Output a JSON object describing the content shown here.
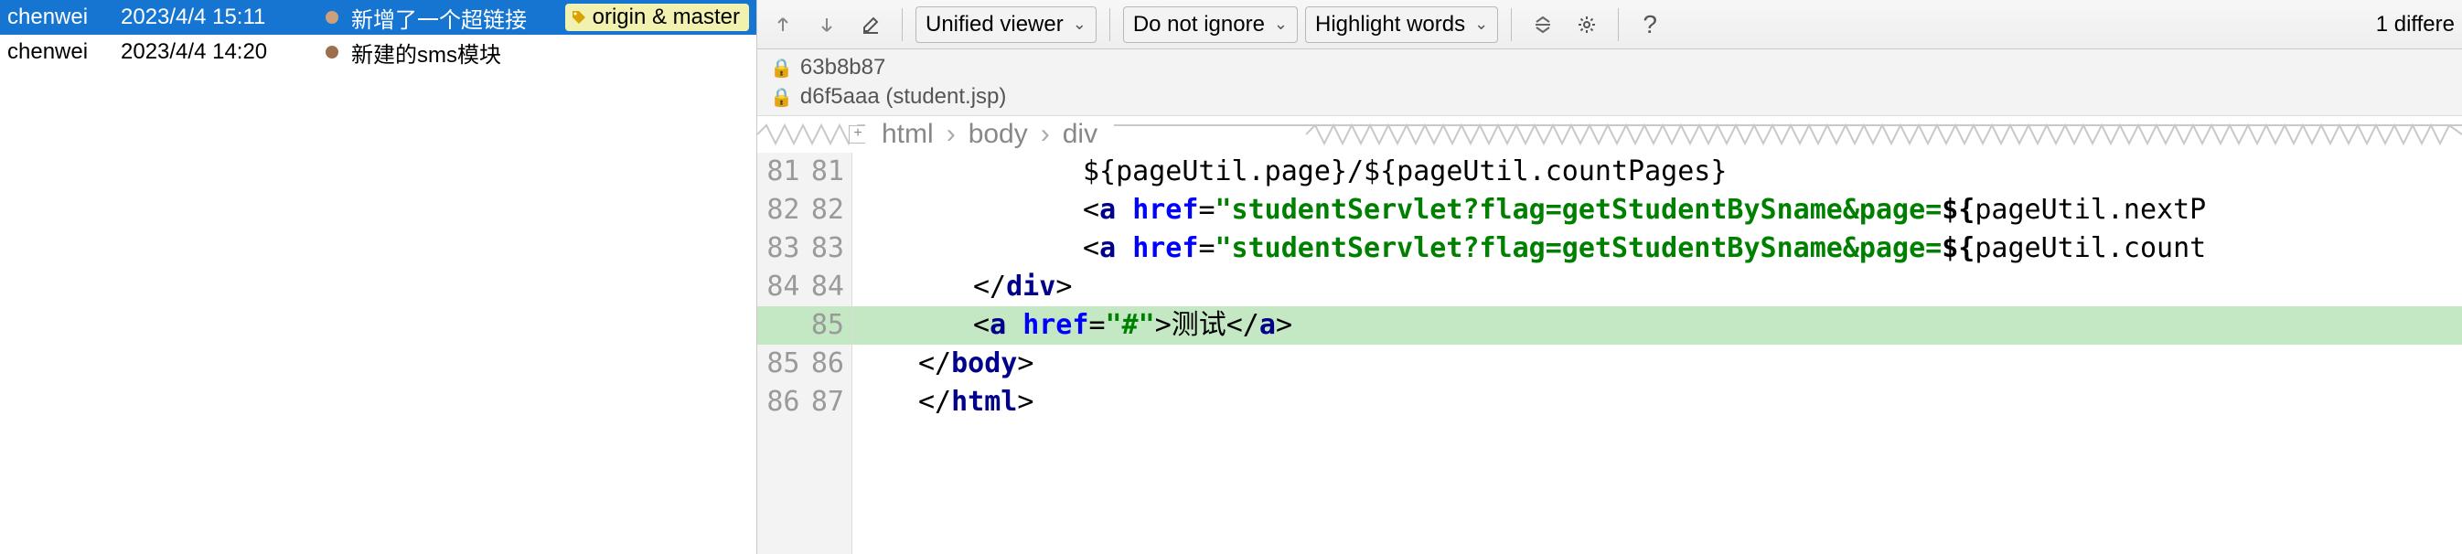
{
  "commits": [
    {
      "author": "chenwei",
      "date": "2023/4/4 15:11",
      "message": "新增了一个超链接",
      "tag": "origin & master",
      "selected": true
    },
    {
      "author": "chenwei",
      "date": "2023/4/4 14:20",
      "message": "新建的sms模块",
      "tag": null,
      "selected": false
    }
  ],
  "toolbar": {
    "viewer_label": "Unified viewer",
    "ignore_label": "Do not ignore",
    "highlight_label": "Highlight words",
    "diff_count": "1 differe"
  },
  "revisions": {
    "base": "63b8b87",
    "head": "d6f5aaa (student.jsp)"
  },
  "breadcrumb": [
    "html",
    "body",
    "div"
  ],
  "code": {
    "lines": [
      {
        "a": "81",
        "b": "81",
        "indent": 3,
        "added": false,
        "tokens": [
          {
            "t": "expr",
            "v": "${pageUtil.page}"
          },
          {
            "t": "text",
            "v": "/"
          },
          {
            "t": "expr",
            "v": "${pageUtil.countPages}"
          }
        ]
      },
      {
        "a": "82",
        "b": "82",
        "indent": 3,
        "added": false,
        "tokens": [
          {
            "t": "punc",
            "v": "<"
          },
          {
            "t": "tag",
            "v": "a "
          },
          {
            "t": "attr",
            "v": "href"
          },
          {
            "t": "punc",
            "v": "="
          },
          {
            "t": "str",
            "v": "\"studentServlet?flag=getStudentBySname&page="
          },
          {
            "t": "br",
            "v": "${"
          },
          {
            "t": "expr",
            "v": "pageUtil.nextP"
          }
        ]
      },
      {
        "a": "83",
        "b": "83",
        "indent": 3,
        "added": false,
        "tokens": [
          {
            "t": "punc",
            "v": "<"
          },
          {
            "t": "tag",
            "v": "a "
          },
          {
            "t": "attr",
            "v": "href"
          },
          {
            "t": "punc",
            "v": "="
          },
          {
            "t": "str",
            "v": "\"studentServlet?flag=getStudentBySname&page="
          },
          {
            "t": "br",
            "v": "${"
          },
          {
            "t": "expr",
            "v": "pageUtil.count"
          }
        ]
      },
      {
        "a": "84",
        "b": "84",
        "indent": 2,
        "added": false,
        "tokens": [
          {
            "t": "punc",
            "v": "</"
          },
          {
            "t": "tag",
            "v": "div"
          },
          {
            "t": "punc",
            "v": ">"
          }
        ]
      },
      {
        "a": "",
        "b": "85",
        "indent": 2,
        "added": true,
        "tokens": [
          {
            "t": "punc",
            "v": "<"
          },
          {
            "t": "tag",
            "v": "a "
          },
          {
            "t": "attr",
            "v": "href"
          },
          {
            "t": "punc",
            "v": "="
          },
          {
            "t": "str",
            "v": "\"#\""
          },
          {
            "t": "punc",
            "v": ">"
          },
          {
            "t": "text",
            "v": "测试"
          },
          {
            "t": "punc",
            "v": "</"
          },
          {
            "t": "tag",
            "v": "a"
          },
          {
            "t": "punc",
            "v": ">"
          }
        ]
      },
      {
        "a": "85",
        "b": "86",
        "indent": 1,
        "added": false,
        "tokens": [
          {
            "t": "punc",
            "v": "</"
          },
          {
            "t": "tag",
            "v": "body"
          },
          {
            "t": "punc",
            "v": ">"
          }
        ]
      },
      {
        "a": "86",
        "b": "87",
        "indent": 1,
        "added": false,
        "tokens": [
          {
            "t": "punc",
            "v": "</"
          },
          {
            "t": "tag",
            "v": "html"
          },
          {
            "t": "punc",
            "v": ">"
          }
        ]
      }
    ]
  }
}
